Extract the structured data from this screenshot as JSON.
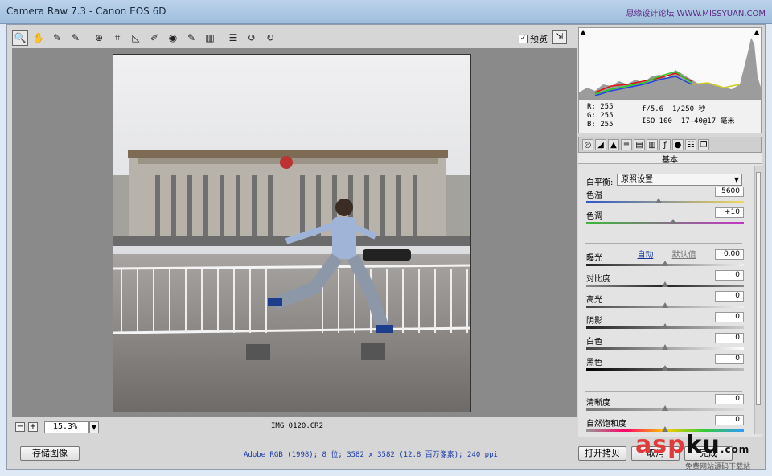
{
  "window": {
    "title": "Camera Raw 7.3 - Canon EOS 6D",
    "watermark": "思缘设计论坛 WWW.MISSYUAN.COM"
  },
  "toolbar": {
    "tools": [
      {
        "icon": "zoom-icon",
        "glyph": "🔍"
      },
      {
        "icon": "hand-icon",
        "glyph": "✋"
      },
      {
        "icon": "white-balance-icon",
        "glyph": "✎"
      },
      {
        "icon": "color-sampler-icon",
        "glyph": "✎"
      },
      {
        "icon": "target-adjust-icon",
        "glyph": "⊕"
      },
      {
        "icon": "crop-icon",
        "glyph": "⌗"
      },
      {
        "icon": "straighten-icon",
        "glyph": "◺"
      },
      {
        "icon": "spot-removal-icon",
        "glyph": "✐"
      },
      {
        "icon": "red-eye-icon",
        "glyph": "◉"
      },
      {
        "icon": "adjustment-brush-icon",
        "glyph": "✎"
      },
      {
        "icon": "graduated-filter-icon",
        "glyph": "▥"
      },
      {
        "icon": "preferences-icon",
        "glyph": "☰"
      },
      {
        "icon": "rotate-left-icon",
        "glyph": "↺"
      },
      {
        "icon": "rotate-right-icon",
        "glyph": "↻"
      }
    ],
    "preview_label": "预览",
    "preview_checked": true
  },
  "status": {
    "zoom": "15.3%",
    "filename": "IMG_0120.CR2"
  },
  "histogram": {
    "rgb": {
      "r": "R:  255",
      "g": "G:  255",
      "b": "B:  255"
    },
    "aperture": "f/5.6",
    "shutter": "1/250 秒",
    "iso": "ISO 100",
    "lens": "17-40@17 毫米"
  },
  "panel": {
    "title": "基本",
    "white_balance_label": "白平衡:",
    "white_balance_value": "原照设置",
    "auto_label": "自动",
    "default_label": "默认值",
    "sliders": [
      {
        "label": "色温",
        "value": "5600",
        "pos": 0.46,
        "gradient": "linear-gradient(90deg,#2f57c8,#f1d85a)"
      },
      {
        "label": "色调",
        "value": "+10",
        "pos": 0.55,
        "gradient": "linear-gradient(90deg,#3ab73a,#c735c7)"
      },
      {
        "label": "曝光",
        "value": "0.00",
        "pos": 0.5,
        "gradient": "linear-gradient(90deg,#222,#eee)"
      },
      {
        "label": "对比度",
        "value": "0",
        "pos": 0.5,
        "gradient": "linear-gradient(90deg,#888,#222,#888)"
      },
      {
        "label": "高光",
        "value": "0",
        "pos": 0.5,
        "gradient": "linear-gradient(90deg,#444,#eee)"
      },
      {
        "label": "阴影",
        "value": "0",
        "pos": 0.5,
        "gradient": "linear-gradient(90deg,#222,#ccc)"
      },
      {
        "label": "白色",
        "value": "0",
        "pos": 0.5,
        "gradient": "linear-gradient(90deg,#444,#fff)"
      },
      {
        "label": "黑色",
        "value": "0",
        "pos": 0.5,
        "gradient": "linear-gradient(90deg,#000,#bbb)"
      },
      {
        "label": "清晰度",
        "value": "0",
        "pos": 0.5,
        "gradient": "linear-gradient(90deg,#777,#ddd)"
      },
      {
        "label": "自然饱和度",
        "value": "0",
        "pos": 0.5,
        "gradient": "linear-gradient(90deg,#999,#f06,#fc0,#3c3,#39f)"
      }
    ]
  },
  "bottom": {
    "save_label": "存储图像",
    "workflow_link": "Adobe RGB (1998); 8 位; 3582 x 3582 (12.8 百万像素); 240 ppi",
    "open_copy_label": "打开拷贝",
    "cancel_label": "取消",
    "done_label": "完成"
  },
  "overlay": {
    "asp_a": "asp",
    "asp_b": "ku",
    "asp_c": ".com",
    "asp_sub": "免费网站源码下载站"
  }
}
